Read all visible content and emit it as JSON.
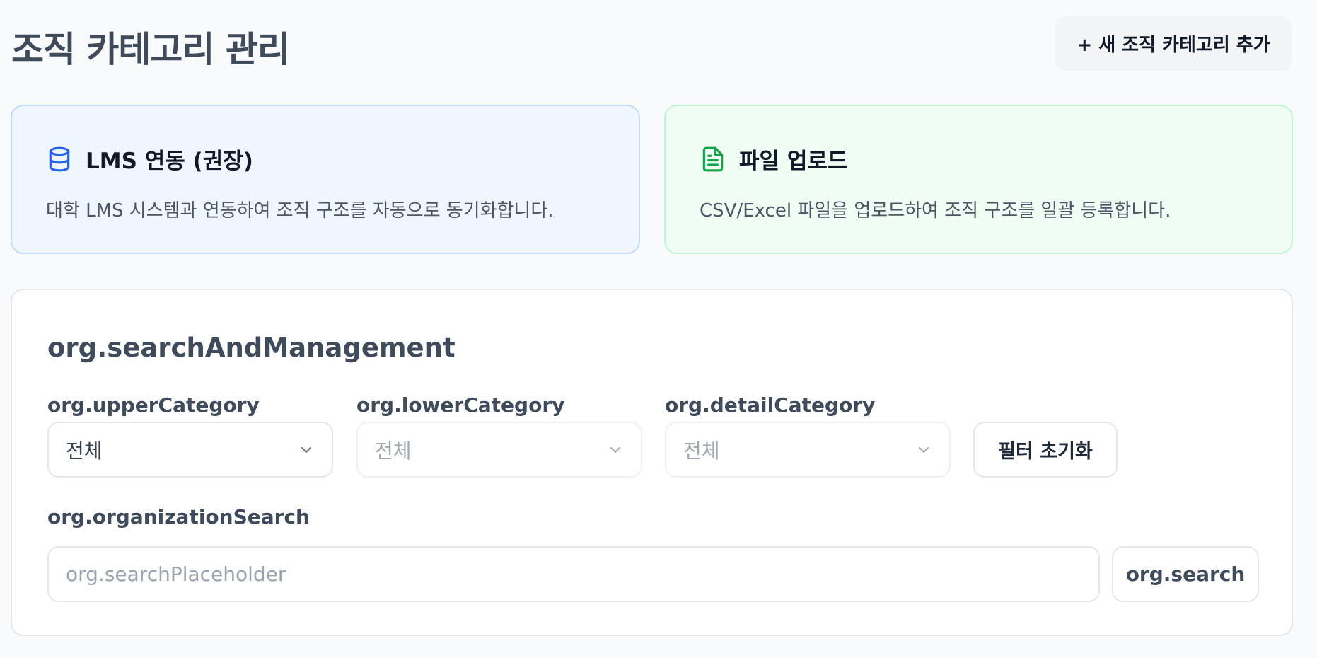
{
  "header": {
    "title": "조직 카테고리 관리",
    "add_button_label": "+ 새 조직 카테고리 추가"
  },
  "cards": {
    "lms": {
      "icon": "database-icon",
      "title": "LMS 연동 (권장)",
      "description": "대학 LMS 시스템과 연동하여 조직 구조를 자동으로 동기화합니다.",
      "accent_color": "#2563eb"
    },
    "file": {
      "icon": "file-text-icon",
      "title": "파일 업로드",
      "description": "CSV/Excel 파일을 업로드하여 조직 구조를 일괄 등록합니다.",
      "accent_color": "#16a34a"
    }
  },
  "panel": {
    "title": "org.searchAndManagement",
    "filters": {
      "upper": {
        "label": "org.upperCategory",
        "value": "전체",
        "disabled": false
      },
      "lower": {
        "label": "org.lowerCategory",
        "value": "전체",
        "disabled": true
      },
      "detail": {
        "label": "org.detailCategory",
        "value": "전체",
        "disabled": true
      }
    },
    "reset_button_label": "필터 초기화",
    "search": {
      "label": "org.organizationSearch",
      "placeholder": "org.searchPlaceholder",
      "value": "",
      "button_label": "org.search"
    }
  }
}
